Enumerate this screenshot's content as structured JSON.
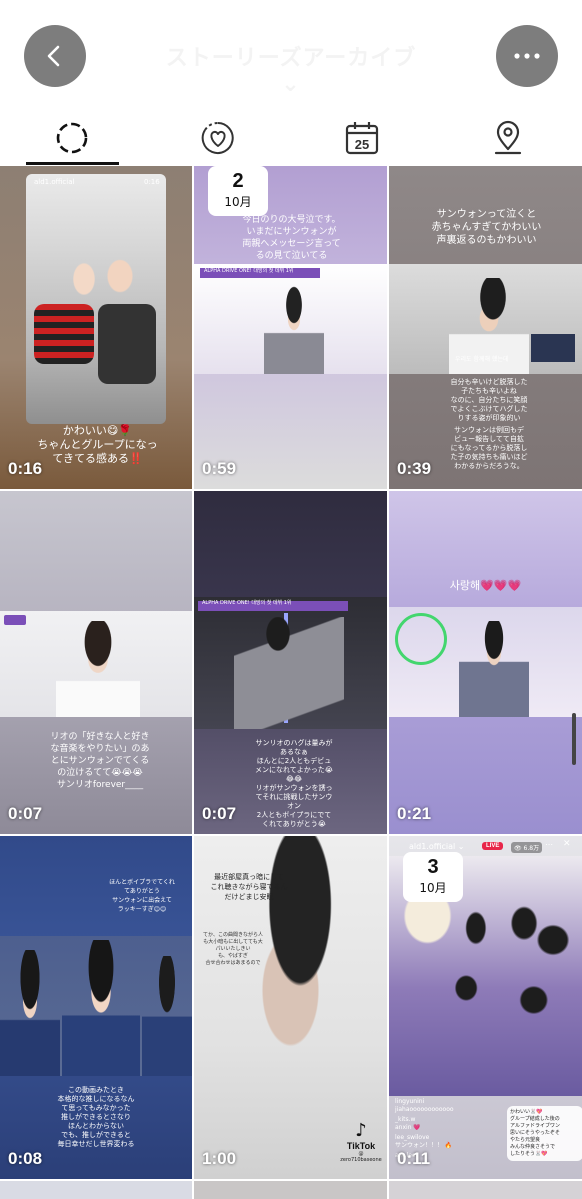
{
  "header": {
    "title": "ストーリーズアーカイブ ⌄",
    "back_icon": "chevron-left-icon",
    "more_icon": "ellipsis-icon"
  },
  "tabs": [
    {
      "name": "stories",
      "icon": "stories-circle-icon",
      "selected": true
    },
    {
      "name": "highlights",
      "icon": "heart-circle-icon",
      "selected": false
    },
    {
      "name": "calendar",
      "icon": "calendar-icon",
      "label": "25",
      "selected": false
    },
    {
      "name": "map",
      "icon": "map-pin-icon",
      "selected": false
    }
  ],
  "tiles": [
    {
      "duration": "0:16",
      "account": "ald1.official",
      "timer": "0:16",
      "caption": "かわいい😋🌹\nちゃんとグループになっ\nてきてる感ある‼️"
    },
    {
      "duration": "0:59",
      "date_day": "2",
      "date_month": "10月",
      "caption": "今日のりの大号泣です。\nいまだにサンウォンが\n両親へメッセージ言って\nるの見て泣いてる",
      "banner": "ALPHA DRIVE ONE! 대망의 첫 데뷔 1위"
    },
    {
      "duration": "0:39",
      "caption": "サンウォンって泣くと\n赤ちゃんすぎてかわいい\n声裏返るのもかわいい",
      "caption2": "自分も辛いけど脱落した\n子たちも辛いよね\nなのに、自分たちに笑顔\nでよくこぶけてハグした\nりする姿が印象的い",
      "caption3": "サンウォンは例回もデ\nビュー報告してて自拡\nにもなってるから脱落し\nた子の気持ちも痛いほど\nわかるからだろうな。",
      "banner": "우리도 함께해 했는데"
    },
    {
      "duration": "0:07",
      "caption": "リオの「好きな人と好き\nな音楽をやりたい」のあ\nとにサンウォンでてくる\nの泣けるてて😭😭😭\nサンリオforever____"
    },
    {
      "duration": "0:07",
      "caption": "サンリオのハグは量みが\nあるなぁ\nほんとに2人ともデビュ\nメンになれてよかった😭\n😂😂\nリオがサンウォンを誘っ\nてそれに挑戦したサンウ\nオン\n2人ともボイプラにでて\nくれてありがとう😭",
      "banner": "ALPHA DRIVE ONE! 대망의 첫 데뷔 1위"
    },
    {
      "duration": "0:21",
      "caption": "사랑해💗💗💗"
    },
    {
      "duration": "0:08",
      "caption": "ほんとボイプラでてくれ\nてありがとう\nサンウォンに出会えて\nラッキーすぎ😊😊",
      "caption2": "この動画みたとき\n本格的な推しになるなん\nて思ってもみなかった\n推しができるとさなり\nほんとわからない\nでも、推しができると\n毎日幸せだし世界変わる"
    },
    {
      "duration": "1:00",
      "caption": "最近部屋真っ暗にして\nこれ聴きながら寝てるん\nだけどまじ安眠",
      "caption2": "てか、この曲聞きながら人\nも大小暗もに出してても大\nパいいたしきい\nも、やばすぎ\n合せ合わせはあまるので",
      "tiktok_label": "TikTok",
      "tiktok_user": "@ zero710baseone"
    },
    {
      "duration": "0:11",
      "date_day": "3",
      "date_month": "10月",
      "account": "ald1.official ⌄",
      "live_label": "LIVE",
      "viewers": "👁 6.8万",
      "comments": [
        {
          "user": "lingyunini",
          "text": "jiahaoooooooooooo"
        },
        {
          "user": "_kits.w",
          "text": "anxin 💗"
        },
        {
          "user": "lee_swilove",
          "text": "サンウォン！！！ 🔥"
        },
        {
          "user": "ark.lee",
          "text": ""
        }
      ],
      "bubble": "かわいい🐰💖\nグループ結成した後の\nアルファドライブワン\n思いにそうやったぞそ\nやたら元望良\nみんな仲良さそうで\nしたりそう🐰💖"
    }
  ],
  "colors": {
    "accent_live": "#e8264a",
    "topbar_button": "#7d7d7d",
    "tab_underline": "#111111"
  }
}
